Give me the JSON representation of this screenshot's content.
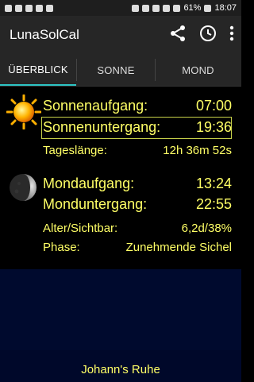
{
  "statusbar": {
    "battery": "61%",
    "time": "18:07"
  },
  "app": {
    "title": "LunaSolCal"
  },
  "tabs": [
    {
      "label": "ÜBERBLICK",
      "active": true
    },
    {
      "label": "SONNE",
      "active": false
    },
    {
      "label": "MOND",
      "active": false
    }
  ],
  "sun": {
    "rise_label": "Sonnenaufgang:",
    "rise_value": "07:00",
    "set_label": "Sonnenuntergang:",
    "set_value": "19:36",
    "daylength_label": "Tageslänge:",
    "daylength_value": "12h 36m 52s"
  },
  "moon": {
    "rise_label": "Mondaufgang:",
    "rise_value": "13:24",
    "set_label": "Monduntergang:",
    "set_value": "22:55",
    "age_label": "Alter/Sichtbar:",
    "age_value": "6,2d/38%",
    "phase_label": "Phase:",
    "phase_value": "Zunehmende Sichel"
  },
  "footer": {
    "location": "Johann's Ruhe"
  },
  "colors": {
    "accent": "#2ec4c4",
    "text_yellow": "#ffff66",
    "footer_bg": "#00082a"
  },
  "icons": [
    "share-icon",
    "clock-icon",
    "more-vert-icon",
    "sun-icon",
    "moon-icon"
  ]
}
